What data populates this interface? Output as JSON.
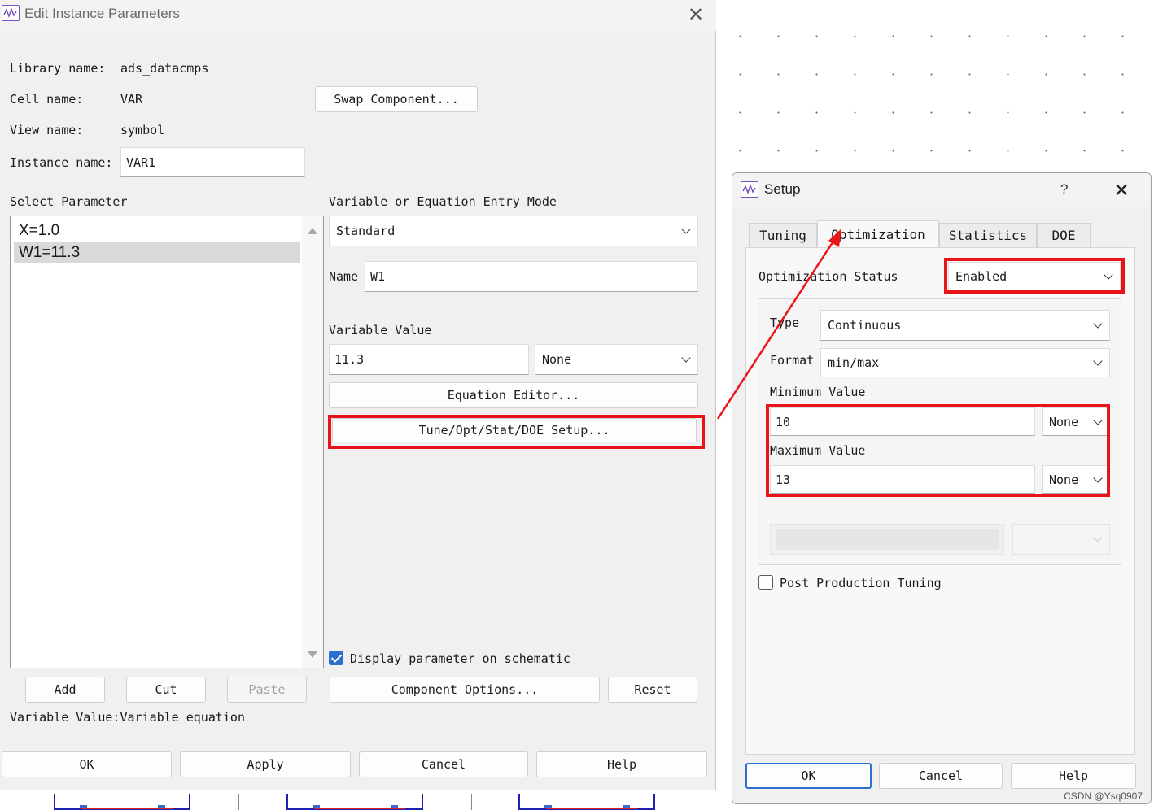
{
  "main_dialog": {
    "title": "Edit Instance Parameters",
    "library_label": "Library name:",
    "library_value": "ads_datacmps",
    "cell_label": "Cell name:",
    "cell_value": "VAR",
    "view_label": "View name:",
    "view_value": "symbol",
    "instance_label": "Instance name:",
    "instance_value": "VAR1",
    "swap_button": "Swap Component...",
    "select_parameter_label": "Select Parameter",
    "parameters": [
      "X=1.0",
      "W1=11.3"
    ],
    "selected_parameter_index": 1,
    "entry_mode_label": "Variable or Equation Entry Mode",
    "entry_mode_value": "Standard",
    "name_label": "Name",
    "name_value": "W1",
    "variable_value_label": "Variable Value",
    "variable_value": "11.3",
    "unit_value": "None",
    "equation_editor_button": "Equation Editor...",
    "setup_button": "Tune/Opt/Stat/DOE Setup...",
    "display_checkbox_label": "Display parameter on schematic",
    "display_checked": true,
    "add_button": "Add",
    "cut_button": "Cut",
    "paste_button": "Paste",
    "component_options_button": "Component Options...",
    "reset_button": "Reset",
    "status_text": "Variable Value:Variable equation",
    "ok_button": "OK",
    "apply_button": "Apply",
    "cancel_button": "Cancel",
    "help_button": "Help",
    "close_icon": "close-icon",
    "app_icon": "ads-app-icon"
  },
  "setup_dialog": {
    "title": "Setup",
    "help_glyph": "?",
    "tabs": [
      "Tuning",
      "Optimization",
      "Statistics",
      "DOE"
    ],
    "active_tab_index": 1,
    "optimization_status_label": "Optimization Status",
    "optimization_status_value": "Enabled",
    "type_label": "Type",
    "type_value": "Continuous",
    "format_label": "Format",
    "format_value": "min/max",
    "minimum_label": "Minimum Value",
    "minimum_value": "10",
    "minimum_unit": "None",
    "maximum_label": "Maximum Value",
    "maximum_value": "13",
    "maximum_unit": "None",
    "post_production_label": "Post Production Tuning",
    "post_production_checked": false,
    "ok_button": "OK",
    "cancel_button": "Cancel",
    "help_button": "Help"
  },
  "watermark": "CSDN @Ysq0907",
  "colors": {
    "highlight_red": "#e8141a",
    "accent_blue": "#2b6fd1",
    "wire_blue": "#1f1fb0"
  }
}
